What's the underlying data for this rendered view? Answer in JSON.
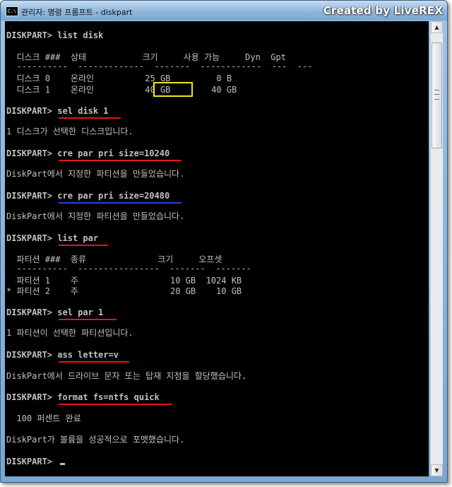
{
  "window": {
    "title": "관리자: 명령 프롬프트 - diskpart",
    "app_icon": "C:\\",
    "watermark": "Created by LiveREX"
  },
  "console": {
    "lines": [
      "DISKPART> list disk",
      "  디스크 ###  상태           크기     사용 가능     Dyn  Gpt",
      "  ----------  -------------  -------  ------------  ---  ---",
      "  디스크 0    온라인          25 GB         0 B",
      "  디스크 1    온라인          40 GB        40 GB",
      "DISKPART> sel disk 1",
      "1 디스크가 선택한 디스크입니다.",
      "DISKPART> cre par pri size=10240",
      "DiskPart에서 지정한 파티션을 만들었습니다.",
      "DISKPART> cre par pri size=20480",
      "DiskPart에서 지정한 파티션을 만들었습니다.",
      "DISKPART> list par",
      "  파티션 ###  종류              크기     오프셋",
      "  ----------  ----------------  -------  -------",
      "  파티션 1    주                  10 GB  1024 KB",
      "* 파티션 2    주                  20 GB    10 GB",
      "DISKPART> sel par 1",
      "1 파티션이 선택한 파티션입니다.",
      "DISKPART> ass letter=v",
      "DiskPart에서 드라이브 문자 또는 탑재 지점을 할당했습니다.",
      "DISKPART> format fs=ntfs quick",
      "  100 퍼센트 완료",
      "DiskPart가 볼륨을 성공적으로 포맷했습니다.",
      "DISKPART> "
    ]
  },
  "colors": {
    "console_bg": "#000000",
    "console_text": "#c0c0c0",
    "underline_red": "#e3151b",
    "underline_blue": "#2a3fcf",
    "highlight_box": "#f2e51a"
  },
  "icons": {
    "app": "cmd-icon",
    "scroll_up": "arrow-up-icon",
    "scroll_down": "arrow-down-icon"
  }
}
